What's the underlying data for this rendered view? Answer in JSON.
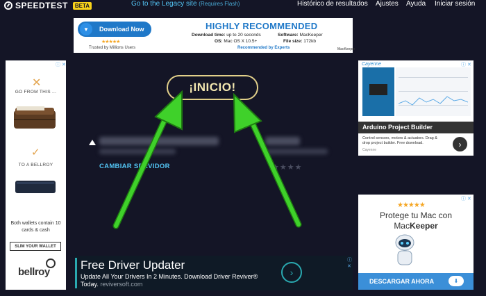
{
  "header": {
    "logo_text": "SPEEDTEST",
    "beta_badge": "BETA",
    "legacy_link": "Go to the Legacy site",
    "legacy_note": "(Requires Flash)",
    "nav": [
      "Histórico de resultados",
      "Ajustes",
      "Ayuda",
      "Iniciar sesión"
    ]
  },
  "main": {
    "go_button": "¡INICIO!",
    "change_server": "CAMBIAR SERVIDOR",
    "isp_stars": "★★★★"
  },
  "ads": {
    "top": {
      "download_button": "Download Now",
      "stars": "★★★★★",
      "trusted": "Trusted by Millions Users",
      "headline": "HIGHLY RECOMMENDED",
      "download_time_label": "Download time:",
      "download_time_value": "up to 20 seconds",
      "os_label": "OS:",
      "os_value": "Mac OS X 10.5+",
      "software_label": "Software:",
      "software_value": "MacKeeper",
      "filesize_label": "File size:",
      "filesize_value": "172kb",
      "recommended": "Recommended by Experts",
      "brand": "MacKeeper"
    },
    "left": {
      "from": "GO FROM THIS ...",
      "to": "TO A BELLROY",
      "both": "Both wallets contain 10 cards & cash",
      "button": "SLIM YOUR WALLET",
      "brand": "bellroy",
      "close": "ⓘ ✕"
    },
    "right_top": {
      "brand": "Cayenne",
      "title": "Arduino Project Builder",
      "description": "Control sensors, motors & actuators. Drag & drop project builder. Free download.",
      "footer": "Cayenne",
      "close": "ⓘ ✕"
    },
    "right_bottom": {
      "stars": "★★★★★",
      "line1": "Protege tu Mac con",
      "line2_a": "Mac",
      "line2_b": "Keeper",
      "cta": "DESCARGAR AHORA",
      "close": "ⓘ ✕"
    },
    "bottom": {
      "title": "Free Driver Updater",
      "subtitle": "Update All Your Drivers In 2 Minutes. Download Driver Reviver® Today.",
      "domain": "reviversoft.com",
      "close": "ⓘ ✕"
    }
  },
  "colors": {
    "background": "#141526",
    "accent_blue": "#53c5f5",
    "go_button": "#e2d08a",
    "arrow_green": "#3fd12a"
  }
}
